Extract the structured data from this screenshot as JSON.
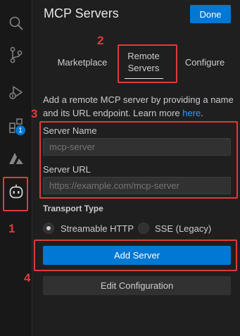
{
  "activity_bar": {
    "items": [
      {
        "icon": "search-icon"
      },
      {
        "icon": "source-control-icon"
      },
      {
        "icon": "run-debug-icon"
      },
      {
        "icon": "extensions-icon",
        "badge": "1"
      },
      {
        "icon": "azure-icon"
      },
      {
        "icon": "copilot-robot-icon"
      }
    ]
  },
  "panel": {
    "title": "MCP Servers",
    "done_label": "Done"
  },
  "tabs": {
    "marketplace": "Marketplace",
    "remote_line1": "Remote",
    "remote_line2": "Servers",
    "configure": "Configure"
  },
  "description": {
    "text": "Add a remote MCP server by providing a name and its URL endpoint. Learn more ",
    "link": "here",
    "end": "."
  },
  "form": {
    "server_name_label": "Server Name",
    "server_name_placeholder": "mcp-server",
    "server_url_label": "Server URL",
    "server_url_placeholder": "https://example.com/mcp-server",
    "transport_label": "Transport Type",
    "transport_options": [
      "Streamable HTTP",
      "SSE (Legacy)"
    ],
    "transport_selected": "Streamable HTTP"
  },
  "buttons": {
    "add_server": "Add Server",
    "edit_configuration": "Edit Configuration"
  },
  "annotations": {
    "step1": "1",
    "step2": "2",
    "step3": "3",
    "step4": "4",
    "color": "#e03a3a"
  },
  "colors": {
    "accent": "#0078d4",
    "link": "#3794ff",
    "background": "#1f1f1f"
  }
}
